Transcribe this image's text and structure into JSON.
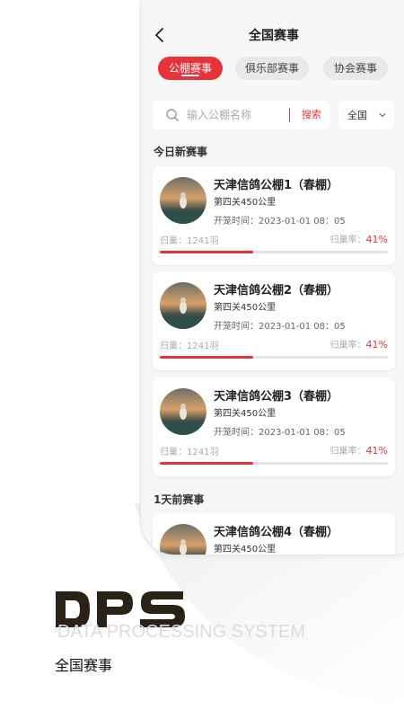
{
  "nav": {
    "title": "全国赛事"
  },
  "tabs": [
    {
      "label": "公棚赛事",
      "active": true
    },
    {
      "label": "俱乐部赛事",
      "active": false
    },
    {
      "label": "协会赛事",
      "active": false
    }
  ],
  "search": {
    "placeholder": "输入公棚名称",
    "button": "搜索",
    "region": "全国"
  },
  "sections": [
    {
      "title": "今日新赛事"
    },
    {
      "title": "1天前赛事"
    }
  ],
  "cards": [
    {
      "title": "天津信鸽公棚1（春棚）",
      "stage": "第四关450公里",
      "time": "开笼时间：2023-01-01 08：05",
      "count": "归巢：1241羽",
      "rate_label": "归巢率：",
      "rate": "41%",
      "rate_value": 0.41
    },
    {
      "title": "天津信鸽公棚2（春棚）",
      "stage": "第四关450公里",
      "time": "开笼时间：2023-01-01 08：05",
      "count": "归巢：1241羽",
      "rate_label": "归巢率：",
      "rate": "41%",
      "rate_value": 0.41
    },
    {
      "title": "天津信鸽公棚3（春棚）",
      "stage": "第四关450公里",
      "time": "开笼时间：2023-01-01 08：05",
      "count": "归巢：1241羽",
      "rate_label": "归巢率：",
      "rate": "41%",
      "rate_value": 0.41
    },
    {
      "title": "天津信鸽公棚4（春棚）",
      "stage": "第四关450公里"
    }
  ],
  "brand": {
    "logo": "DPS",
    "tagline": "DATA PROCESSING SYSTEM",
    "caption": "全国赛事"
  },
  "colors": {
    "accent": "#e8323a",
    "logo": "#2b2217"
  },
  "icons": [
    "chevron-left-icon",
    "search-icon",
    "chevron-down-icon",
    "pigeon-avatar"
  ]
}
